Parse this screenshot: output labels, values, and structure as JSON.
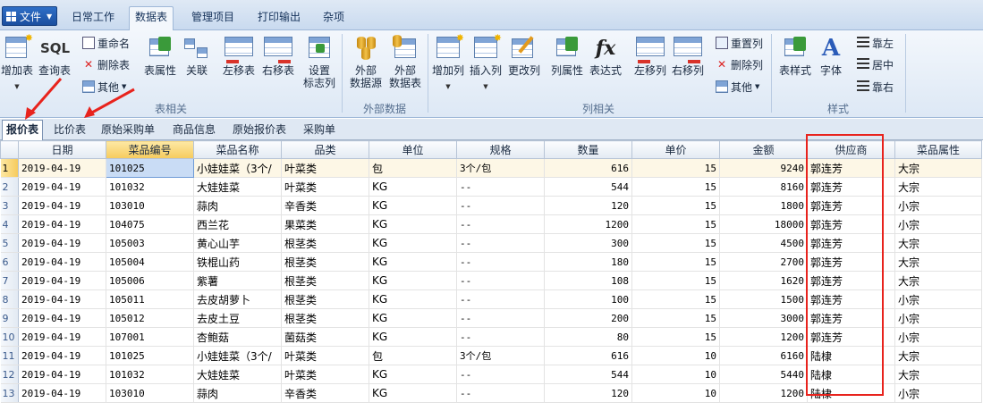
{
  "menubar": {
    "file_label": "文件",
    "tabs": [
      "日常工作",
      "数据表",
      "管理项目",
      "打印输出",
      "杂项"
    ],
    "active_tab": 1
  },
  "ribbon": {
    "btn_add_table": "增加表",
    "btn_query_table": "查询表",
    "sql_text": "SQL",
    "btn_rename": "重命名",
    "btn_delete_table": "删除表",
    "btn_other1": "其他",
    "btn_table_props": "表属性",
    "btn_relate": "关联",
    "btn_move_table_left": "左移表",
    "btn_move_table_right": "右移表",
    "btn_set_flag_col_1": "设置",
    "btn_set_flag_col_2": "标志列",
    "group_table": "表相关",
    "btn_ext_source_1": "外部",
    "btn_ext_source_2": "数据源",
    "btn_ext_table_1": "外部",
    "btn_ext_table_2": "数据表",
    "group_external": "外部数据",
    "btn_add_col": "增加列",
    "btn_insert_col": "插入列",
    "btn_modify_col": "更改列",
    "btn_col_props": "列属性",
    "btn_expression": "表达式",
    "fx_text": "fx",
    "btn_move_col_left": "左移列",
    "btn_move_col_right": "右移列",
    "btn_reset_col": "重置列",
    "btn_delete_col": "删除列",
    "btn_other2": "其他",
    "group_column": "列相关",
    "btn_table_style": "表样式",
    "btn_font": "字体",
    "font_glyph": "A",
    "btn_align_left": "靠左",
    "btn_align_center": "居中",
    "btn_align_right": "靠右",
    "group_style": "样式"
  },
  "sheet_tabs": [
    "报价表",
    "比价表",
    "原始采购单",
    "商品信息",
    "原始报价表",
    "采购单"
  ],
  "active_sheet": 0,
  "grid": {
    "columns": [
      "日期",
      "菜品编号",
      "菜品名称",
      "品类",
      "单位",
      "规格",
      "数量",
      "单价",
      "金额",
      "供应商",
      "菜品属性"
    ],
    "selected_column": 1,
    "rows": [
      [
        "1",
        "2019-04-19",
        "101025",
        "小娃娃菜（3个/",
        "叶菜类",
        "包",
        "3个/包",
        "616",
        "15",
        "9240",
        "郭连芳",
        "大宗"
      ],
      [
        "2",
        "2019-04-19",
        "101032",
        "大娃娃菜",
        "叶菜类",
        "KG",
        "--",
        "544",
        "15",
        "8160",
        "郭连芳",
        "大宗"
      ],
      [
        "3",
        "2019-04-19",
        "103010",
        "蒜肉",
        "辛香类",
        "KG",
        "--",
        "120",
        "15",
        "1800",
        "郭连芳",
        "小宗"
      ],
      [
        "4",
        "2019-04-19",
        "104075",
        "西兰花",
        "果菜类",
        "KG",
        "--",
        "1200",
        "15",
        "18000",
        "郭连芳",
        "小宗"
      ],
      [
        "5",
        "2019-04-19",
        "105003",
        "黄心山芋",
        "根茎类",
        "KG",
        "--",
        "300",
        "15",
        "4500",
        "郭连芳",
        "大宗"
      ],
      [
        "6",
        "2019-04-19",
        "105004",
        "铁棍山药",
        "根茎类",
        "KG",
        "--",
        "180",
        "15",
        "2700",
        "郭连芳",
        "大宗"
      ],
      [
        "7",
        "2019-04-19",
        "105006",
        "紫薯",
        "根茎类",
        "KG",
        "--",
        "108",
        "15",
        "1620",
        "郭连芳",
        "大宗"
      ],
      [
        "8",
        "2019-04-19",
        "105011",
        "去皮胡萝卜",
        "根茎类",
        "KG",
        "--",
        "100",
        "15",
        "1500",
        "郭连芳",
        "小宗"
      ],
      [
        "9",
        "2019-04-19",
        "105012",
        "去皮土豆",
        "根茎类",
        "KG",
        "--",
        "200",
        "15",
        "3000",
        "郭连芳",
        "小宗"
      ],
      [
        "10",
        "2019-04-19",
        "107001",
        "杏鲍菇",
        "菌菇类",
        "KG",
        "--",
        "80",
        "15",
        "1200",
        "郭连芳",
        "小宗"
      ],
      [
        "11",
        "2019-04-19",
        "101025",
        "小娃娃菜（3个/",
        "叶菜类",
        "包",
        "3个/包",
        "616",
        "10",
        "6160",
        "陆棣",
        "大宗"
      ],
      [
        "12",
        "2019-04-19",
        "101032",
        "大娃娃菜",
        "叶菜类",
        "KG",
        "--",
        "544",
        "10",
        "5440",
        "陆棣",
        "大宗"
      ],
      [
        "13",
        "2019-04-19",
        "103010",
        "蒜肉",
        "辛香类",
        "KG",
        "--",
        "120",
        "10",
        "1200",
        "陆棣",
        "小宗"
      ]
    ]
  },
  "colors": {
    "ribbon_bg": "#dde8f5",
    "file_button": "#1b4f9f",
    "selected_header": "#f6cb5d",
    "annotation_red": "#e8231d"
  }
}
